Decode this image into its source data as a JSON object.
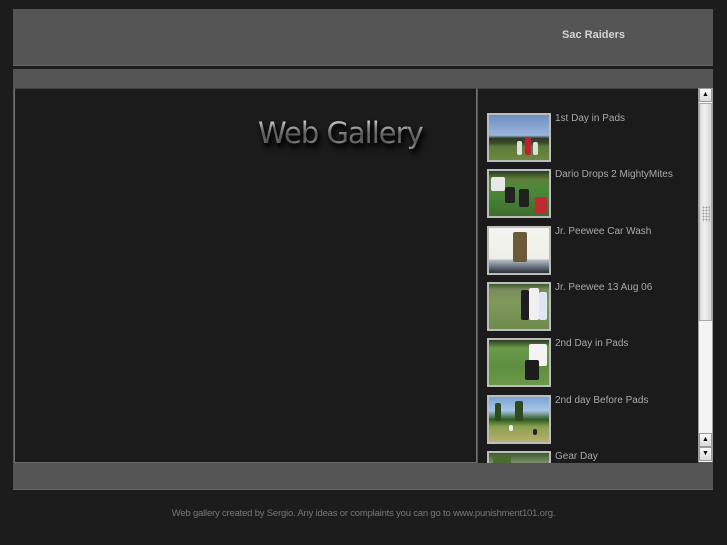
{
  "header": {
    "site_title": "Sac Raiders"
  },
  "main": {
    "gallery_title": "Web Gallery"
  },
  "sidebar": {
    "albums": [
      {
        "label": "1st Day in Pads",
        "thumbnail": "practice-field-photo"
      },
      {
        "label": "Dario Drops 2 MightyMites",
        "thumbnail": "players-on-field-photo"
      },
      {
        "label": "Jr. Peewee Car Wash",
        "thumbnail": "person-on-car-photo"
      },
      {
        "label": "Jr. Peewee 13 Aug 06",
        "thumbnail": "team-gathering-photo"
      },
      {
        "label": "2nd Day in Pads",
        "thumbnail": "players-in-pads-photo"
      },
      {
        "label": "2nd day Before Pads",
        "thumbnail": "field-with-trees-photo"
      },
      {
        "label": "Gear Day",
        "thumbnail": "gear-day-photo"
      }
    ]
  },
  "scrollbar": {
    "up_icon": "arrow-up-icon",
    "down_icon": "arrow-down-icon",
    "up_glyph": "▲",
    "down_glyph": "▼"
  },
  "footer": {
    "credit_text": "Web gallery created by Sergio. Any ideas or complaints you can go to www.punishment101.org."
  },
  "colors": {
    "background": "#1c1c1c",
    "panel": "#555555",
    "content": "#1b1b1b",
    "text": "#a8a8a8"
  }
}
